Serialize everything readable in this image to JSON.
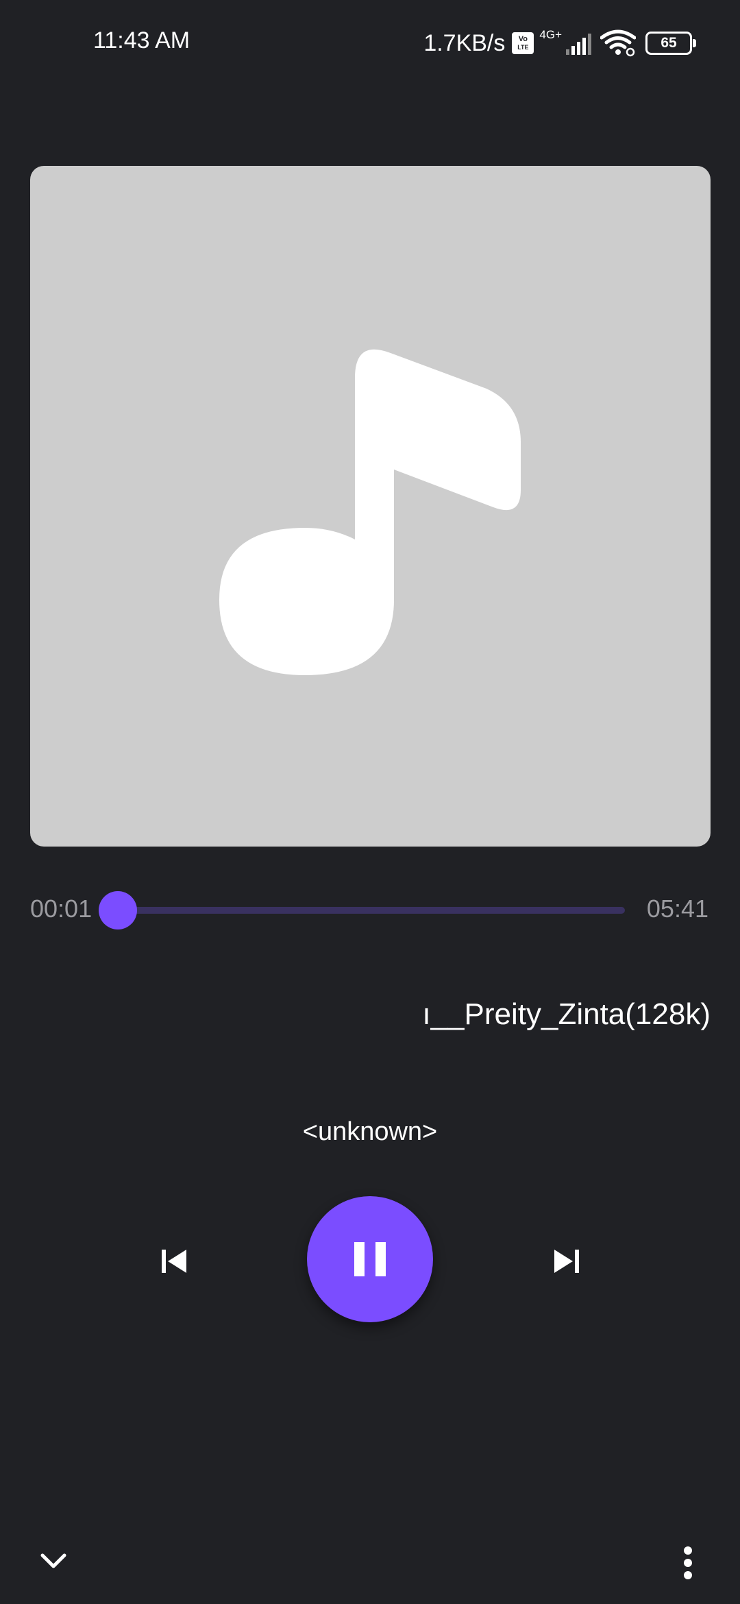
{
  "status_bar": {
    "time": "11:43 AM",
    "net_speed": "1.7KB/s",
    "volte_top": "Vo",
    "volte_bottom": "LTE",
    "network_type": "4G+",
    "battery_level": "65",
    "icons": [
      "volte-icon",
      "signal-icon",
      "wifi-icon",
      "battery-icon"
    ]
  },
  "player": {
    "album_art_icon": "music-note-icon",
    "elapsed": "00:01",
    "total": "05:41",
    "progress": 0.003,
    "title": "ı__Preity_Zinta(128k)",
    "artist": "<unknown>",
    "state": "playing"
  },
  "controls": {
    "prev_icon": "skip-previous-icon",
    "play_pause_icon": "pause-icon",
    "next_icon": "skip-next-icon"
  },
  "bottom_bar": {
    "collapse_icon": "chevron-down-icon",
    "more_icon": "more-vert-icon"
  },
  "colors": {
    "background": "#202125",
    "accent": "#7b4dff",
    "track": "#393160",
    "art_background": "#cdcdcd",
    "secondary_text": "#9b9ba0"
  }
}
